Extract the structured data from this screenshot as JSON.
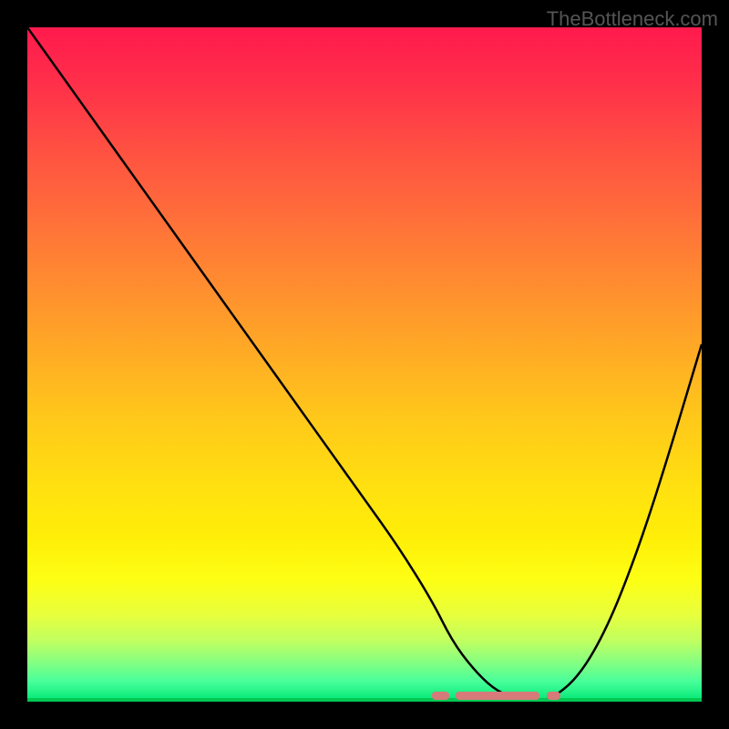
{
  "watermark": "TheBottleneck.com",
  "chart_data": {
    "type": "line",
    "title": "",
    "xlabel": "",
    "ylabel": "",
    "xlim": [
      0,
      100
    ],
    "ylim": [
      0,
      100
    ],
    "x": [
      0,
      5,
      10,
      15,
      20,
      25,
      30,
      35,
      40,
      45,
      50,
      55,
      60,
      63,
      66,
      69,
      72,
      75,
      78,
      82,
      86,
      90,
      94,
      100
    ],
    "values": [
      100,
      93,
      86,
      79,
      72,
      65,
      58,
      51,
      44,
      37,
      30,
      23,
      15,
      9,
      5,
      2,
      0.5,
      0,
      0.5,
      4,
      11,
      21,
      33,
      53
    ],
    "optimal_range": {
      "start": 62,
      "end": 78
    },
    "marker_segments": [
      {
        "start": 60,
        "end": 62.5
      },
      {
        "start": 63.5,
        "end": 76
      },
      {
        "start": 77,
        "end": 79
      }
    ]
  }
}
